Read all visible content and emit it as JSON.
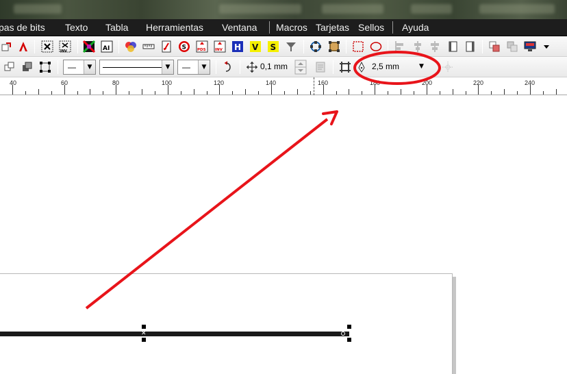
{
  "menu": {
    "items": [
      {
        "label": "pas de bits"
      },
      {
        "label": "Texto"
      },
      {
        "label": "Tabla"
      },
      {
        "label": "Herramientas"
      },
      {
        "label": "Ventana"
      },
      {
        "label": "Macros"
      },
      {
        "label": "Tarjetas"
      },
      {
        "label": "Sellos"
      },
      {
        "label": "Ayuda"
      }
    ]
  },
  "toolbar1": {
    "icons": [
      {
        "name": "export-icon"
      },
      {
        "name": "adobe-pdf-icon"
      },
      {
        "name": "trace-icon"
      },
      {
        "name": "inverse-icon"
      },
      {
        "name": "color-grid-icon"
      },
      {
        "name": "ai-import-icon"
      },
      {
        "name": "color-balls-icon"
      },
      {
        "name": "dimension-icon"
      },
      {
        "name": "fill-red-icon"
      },
      {
        "name": "s-red-icon"
      },
      {
        "name": "pds-icon"
      },
      {
        "name": "inv-icon"
      },
      {
        "name": "h-blue-icon"
      },
      {
        "name": "v-yellow-icon"
      },
      {
        "name": "s-yellow-icon"
      },
      {
        "name": "funnel-icon"
      },
      {
        "name": "node-circle-icon"
      },
      {
        "name": "node-square-icon"
      },
      {
        "name": "dotted-rect-icon"
      },
      {
        "name": "ellipse-icon"
      },
      {
        "name": "align-left-icon"
      },
      {
        "name": "align-center-icon"
      },
      {
        "name": "align-right-icon"
      },
      {
        "name": "page-front-icon"
      },
      {
        "name": "page-back-icon"
      },
      {
        "name": "arrange-icon"
      },
      {
        "name": "arrange2-icon"
      },
      {
        "name": "monitor-icon"
      },
      {
        "name": "more-dropdown-icon"
      }
    ],
    "text": {
      "ai": "AI",
      "pds": "PDS",
      "inv": "INV",
      "h": "H",
      "v": "V",
      "s": "S",
      "trace": "✕",
      "invlabel": "INV"
    }
  },
  "toolbar2": {
    "outline_width": "0,1 mm",
    "corner_value": "2,5 mm",
    "line_start_value": "—",
    "line_end_value": "—"
  },
  "ruler": {
    "labels": [
      "40",
      "60",
      "80",
      "100",
      "120",
      "140",
      "160",
      "180",
      "200",
      "220",
      "240"
    ]
  },
  "annotation": {
    "highlight_color": "#e8141a",
    "arrow_color": "#e8141a"
  }
}
